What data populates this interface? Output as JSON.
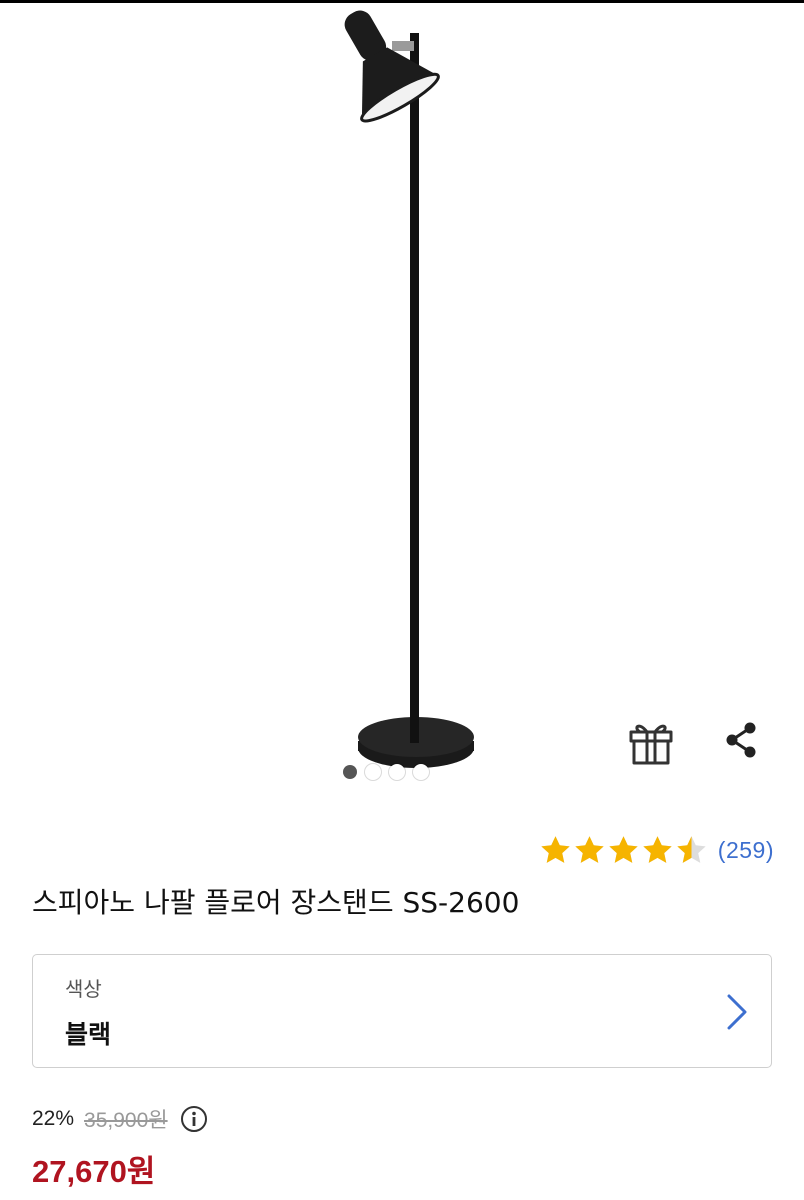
{
  "product": {
    "title": "스피아노 나팔 플로어 장스탠드 SS-2600",
    "image_icon": "floor-lamp-image",
    "rating": {
      "stars": 4.5,
      "max_stars": 5,
      "review_count": "(259)",
      "star_color": "#f6b400"
    },
    "option": {
      "label": "색상",
      "value": "블랙",
      "icon": "chevron-right-icon",
      "chevron_color": "#3d6fcf"
    },
    "price": {
      "discount": "22%",
      "original": "35,900원",
      "sale": "27,670원",
      "sale_color": "#b01420",
      "info_icon": "info-circle-icon"
    }
  },
  "actions": {
    "gift_icon": "gift-icon",
    "share_icon": "share-icon"
  },
  "carousel": {
    "active_index": 0,
    "dot_count": 4
  }
}
